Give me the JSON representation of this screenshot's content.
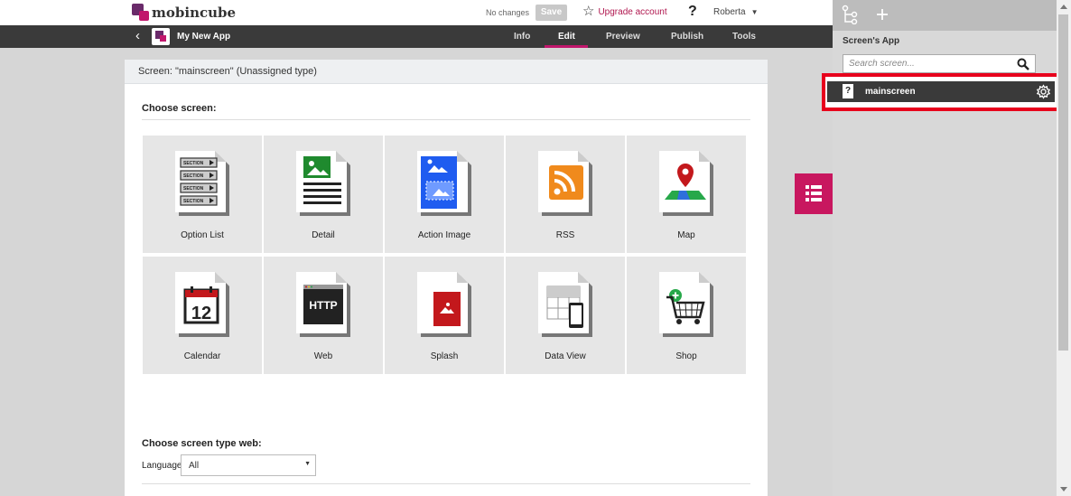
{
  "header": {
    "logo_text": "mobincube",
    "status": "No changes",
    "save_label": "Save",
    "upgrade_label": "Upgrade account",
    "help_label": "?",
    "user_name": "Roberta"
  },
  "nav": {
    "app_name": "My New App",
    "tabs": [
      {
        "label": "Info"
      },
      {
        "label": "Edit"
      },
      {
        "label": "Preview"
      },
      {
        "label": "Publish"
      },
      {
        "label": "Tools"
      }
    ],
    "active_tab": "Edit"
  },
  "main": {
    "screen_header": "Screen: \"mainscreen\" (Unassigned type)",
    "choose_screen_title": "Choose screen:",
    "tiles": [
      {
        "label": "Option List",
        "icon": "option-list-icon"
      },
      {
        "label": "Detail",
        "icon": "detail-icon"
      },
      {
        "label": "Action Image",
        "icon": "action-image-icon"
      },
      {
        "label": "RSS",
        "icon": "rss-icon"
      },
      {
        "label": "Map",
        "icon": "map-icon"
      },
      {
        "label": "Calendar",
        "icon": "calendar-icon"
      },
      {
        "label": "Web",
        "icon": "web-icon"
      },
      {
        "label": "Splash",
        "icon": "splash-icon"
      },
      {
        "label": "Data View",
        "icon": "data-view-icon"
      },
      {
        "label": "Shop",
        "icon": "shop-icon"
      }
    ],
    "option_list_section_text": "SECTION",
    "calendar_day": "12",
    "web_text": "HTTP",
    "web_section_title": "Choose screen type web:",
    "language_label": "Language",
    "language_value": "All"
  },
  "sidebar": {
    "title": "Screen's App",
    "search_placeholder": "Search screen...",
    "screens": [
      {
        "name": "mainscreen",
        "type_icon": "?"
      }
    ]
  },
  "colors": {
    "accent": "#c8175f",
    "nav_bg": "#3a3a3a",
    "highlight_border": "#e8001c"
  }
}
